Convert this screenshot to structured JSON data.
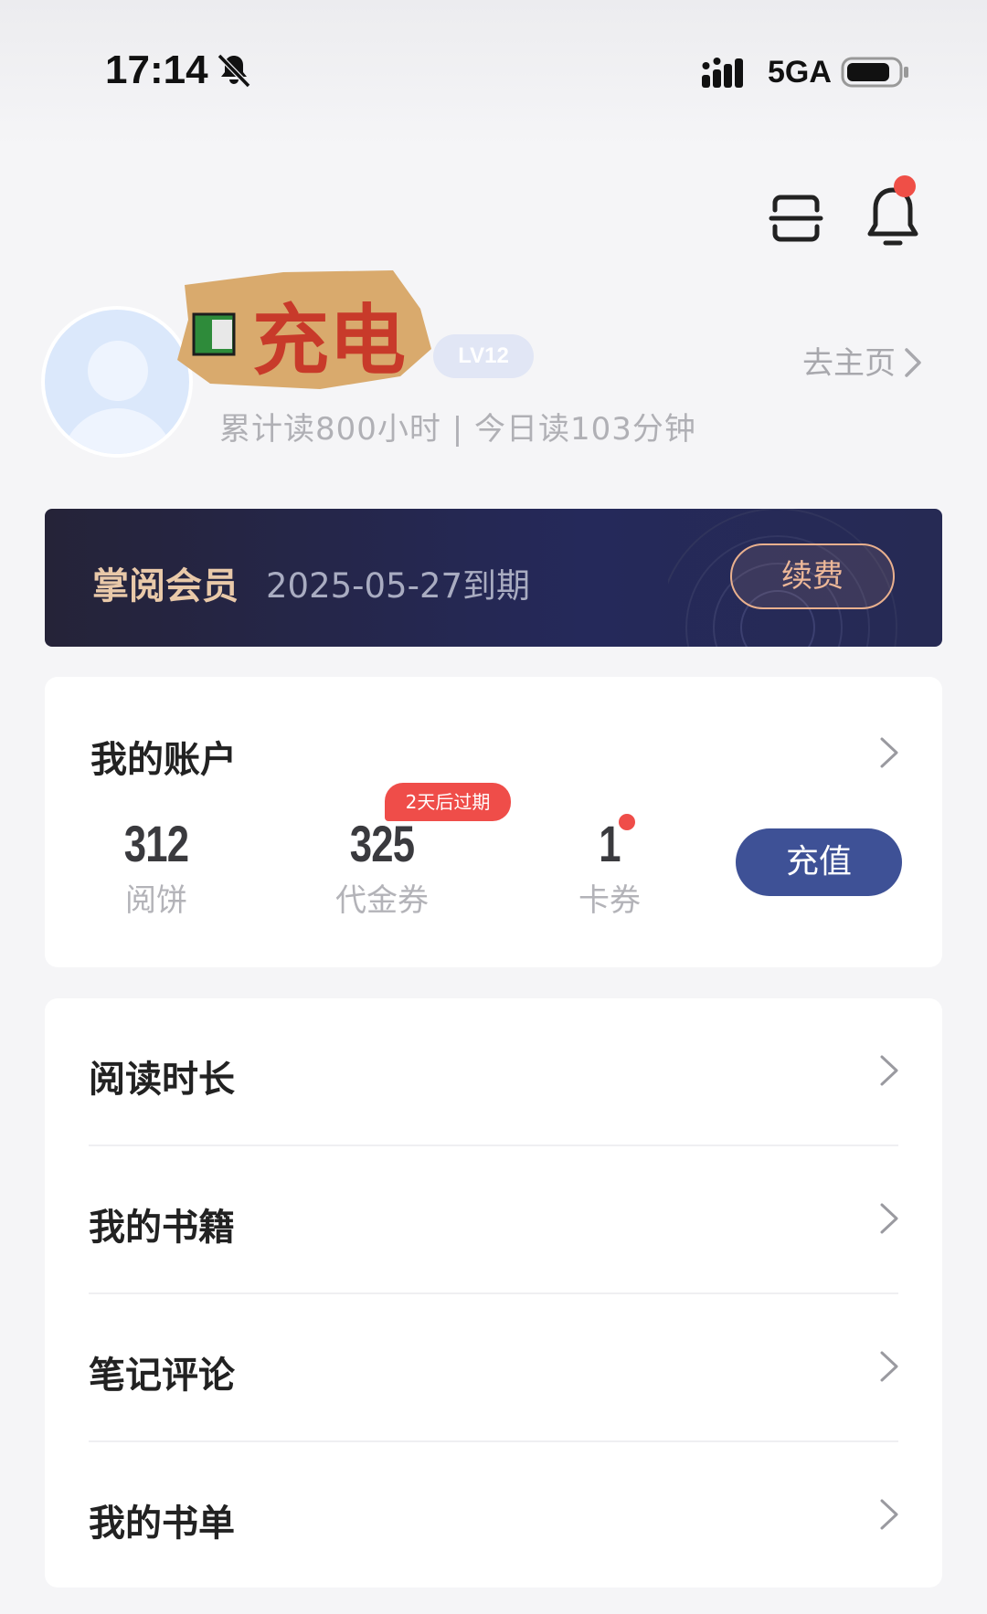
{
  "status_bar": {
    "time": "17:14",
    "network": "5GA",
    "icons": [
      "bell-slash-icon",
      "signal-icon",
      "battery-icon"
    ]
  },
  "header": {
    "icons": [
      "scan-icon",
      "bell-icon"
    ]
  },
  "profile": {
    "nickname": "充电",
    "level": "LV12",
    "homepage_link": "去主页",
    "reading_stats": "累计读800小时 | 今日读103分钟"
  },
  "membership": {
    "title": "掌阅会员",
    "expiry": "2025-05-27到期",
    "renew_label": "续费"
  },
  "account": {
    "title": "我的账户",
    "stats": [
      {
        "value": "312",
        "label": "阅饼"
      },
      {
        "value": "325",
        "label": "代金券"
      },
      {
        "value": "1",
        "label": "卡券"
      }
    ],
    "expire_badge": "2天后过期",
    "recharge_label": "充值"
  },
  "menu": {
    "items": [
      {
        "label": "阅读时长"
      },
      {
        "label": "我的书籍"
      },
      {
        "label": "笔记评论"
      },
      {
        "label": "我的书单"
      }
    ]
  },
  "colors": {
    "background": "#f5f5f7",
    "member_banner": "#25295a",
    "member_accent": "#e9c9a9",
    "recharge_button": "#3e5196",
    "badge_red": "#ef4d49"
  }
}
